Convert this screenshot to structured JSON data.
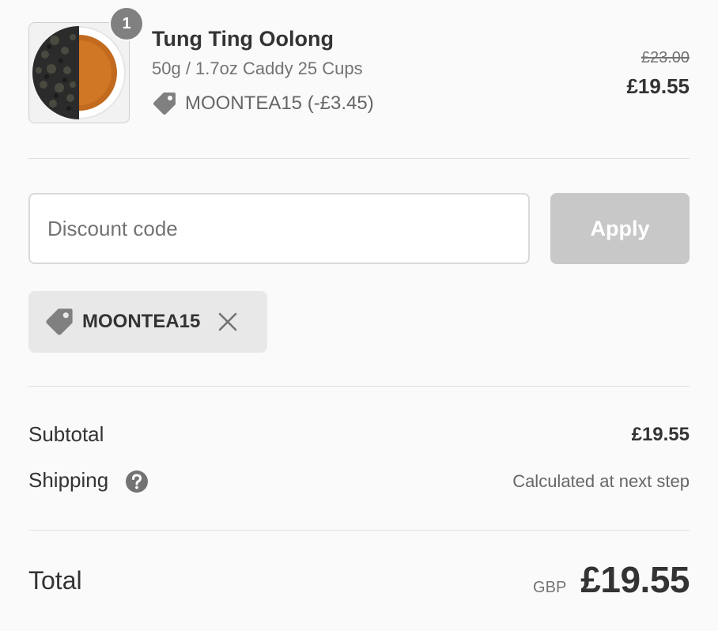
{
  "product": {
    "image_icon": "oolong-tea-thumbnail",
    "quantity": "1",
    "title": "Tung Ting Oolong",
    "variant": "50g / 1.7oz Caddy 25 Cups",
    "discount_line": "MOONTEA15 (-£3.45)",
    "original_price": "£23.00",
    "price": "£19.55"
  },
  "discount": {
    "placeholder": "Discount code",
    "value": "",
    "apply_label": "Apply",
    "applied_code": "MOONTEA15"
  },
  "summary": {
    "subtotal_label": "Subtotal",
    "subtotal_value": "£19.55",
    "shipping_label": "Shipping",
    "shipping_value": "Calculated at next step",
    "total_label": "Total",
    "currency": "GBP",
    "total_value": "£19.55"
  },
  "colors": {
    "background": "#fafafa",
    "badge": "#808080",
    "apply_button_disabled": "#c8c8c8",
    "chip_background": "#e8e8e8",
    "text_primary": "#333333",
    "text_secondary": "#737373"
  },
  "icons": [
    "tag-icon",
    "close-icon",
    "question-circle-icon"
  ]
}
